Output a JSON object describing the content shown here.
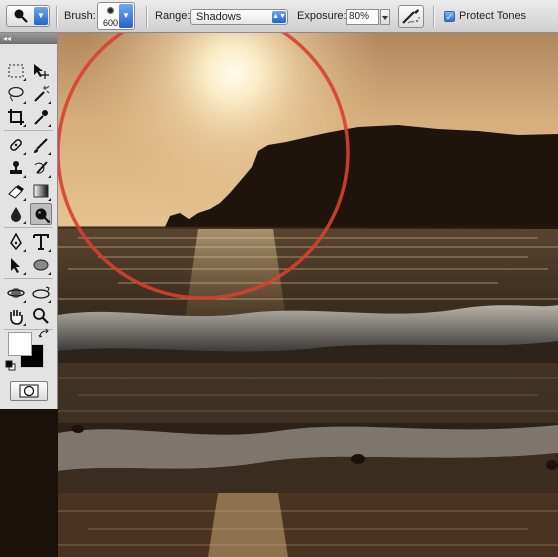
{
  "options_bar": {
    "tool_preset_icon": "burn-tool-icon",
    "brush_label": "Brush:",
    "brush_size": "600",
    "range_label": "Range:",
    "range_value": "Shadows",
    "exposure_label": "Exposure:",
    "exposure_value": "80%",
    "airbrush_icon": "airbrush-icon",
    "protect_tones_checked": true,
    "protect_tones_label": "Protect Tones"
  },
  "toolbox": {
    "header_glyph": "◂◂",
    "tools": [
      "rectangular-marquee-icon",
      "move-icon",
      "lasso-icon",
      "magic-wand-icon",
      "crop-icon",
      "eyedropper-icon",
      "spot-healing-icon",
      "brush-icon",
      "clone-stamp-icon",
      "history-brush-icon",
      "eraser-icon",
      "gradient-icon",
      "blur-icon",
      "burn-icon",
      "pen-icon",
      "type-icon",
      "path-selection-icon",
      "ellipse-shape-icon",
      "3d-rotate-icon",
      "3d-orbit-icon",
      "hand-icon",
      "zoom-icon"
    ],
    "selected_tool": "burn-icon",
    "foreground_color": "#ffffff",
    "background_color": "#000000",
    "quick_mask_icon": "quick-mask-icon"
  },
  "canvas": {
    "content": "sunset-sea-photo",
    "brush_cursor_color": "#d8402c"
  }
}
